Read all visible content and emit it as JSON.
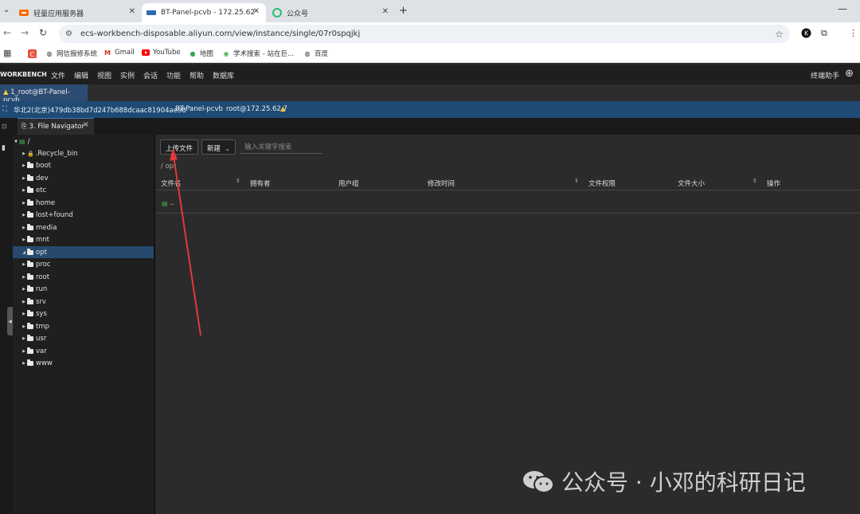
{
  "browser": {
    "tabs": [
      {
        "title": "轻量应用服务器",
        "active": false
      },
      {
        "title": "BT-Panel-pcvb - 172.25.62.7",
        "active": true
      },
      {
        "title": "公众号",
        "active": false
      }
    ],
    "url": "ecs-workbench-disposable.aliyun.com/view/instance/single/07r0spqjkj",
    "bookmarks": [
      "网信报修系统",
      "Gmail",
      "YouTube",
      "地图",
      "学术搜索 - 站在巨...",
      "百度"
    ],
    "brand_color": "#1e4a73"
  },
  "workbench": {
    "brand": "WORKBENCH",
    "menu": [
      "文件",
      "编辑",
      "视图",
      "实例",
      "会话",
      "功能",
      "帮助",
      "数据库"
    ],
    "assistant": "终端助手",
    "session_tab": "1_root@BT-Panel-pcvb",
    "info": {
      "region": "华北2(北京)479db38bd7d247b688dcaac81904ae98",
      "host": "BT-Panel-pcvb",
      "user": "root@172.25.62.7"
    },
    "pane_tab": "3. File Navigator"
  },
  "tree": {
    "root": "/",
    "items": [
      ".Recycle_bin",
      "boot",
      "dev",
      "etc",
      "home",
      "lost+found",
      "media",
      "mnt",
      "opt",
      "proc",
      "root",
      "run",
      "srv",
      "sys",
      "tmp",
      "usr",
      "var",
      "www"
    ],
    "selected": "opt"
  },
  "file_panel": {
    "upload_label": "上传文件",
    "new_label": "新建",
    "search_placeholder": "输入关键字搜索",
    "path": "/  opt",
    "columns": [
      "文件名",
      "拥有者",
      "用户组",
      "修改时间",
      "文件权限",
      "文件大小",
      "操作"
    ],
    "rows": [
      ".."
    ]
  },
  "watermark": "公众号 · 小邓的科研日记"
}
